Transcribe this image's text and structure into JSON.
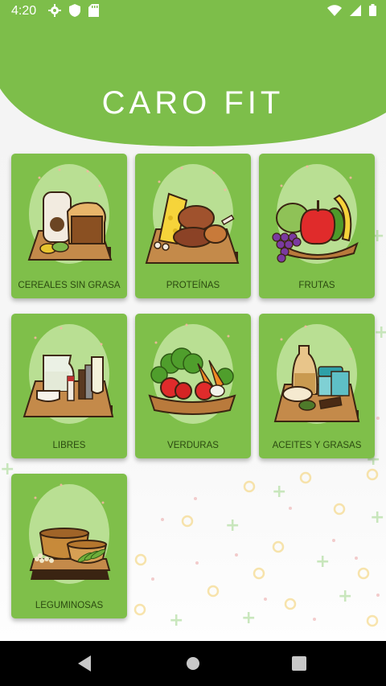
{
  "status_bar": {
    "time": "4:20",
    "left_icons": [
      "gear-icon",
      "shield-icon",
      "sd-card-icon"
    ],
    "right_icons": [
      "wifi-icon",
      "signal-icon",
      "battery-icon"
    ]
  },
  "header": {
    "title": "CARO FIT",
    "color": "#7dbe4a"
  },
  "categories": [
    {
      "label": "CEREALES SIN GRASA",
      "illustration": "bread-and-cereal-icon"
    },
    {
      "label": "PROTEÍNAS",
      "illustration": "meat-and-cheese-icon"
    },
    {
      "label": "FRUTAS",
      "illustration": "fruit-basket-icon"
    },
    {
      "label": "LIBRES",
      "illustration": "drinks-and-condiments-icon"
    },
    {
      "label": "VERDURAS",
      "illustration": "vegetable-basket-icon"
    },
    {
      "label": "ACEITES Y GRASAS",
      "illustration": "oils-and-fats-icon"
    },
    {
      "label": "LEGUMINOSAS",
      "illustration": "legumes-bowls-icon"
    }
  ],
  "nav_bar": {
    "buttons": [
      "back-icon",
      "home-icon",
      "recents-icon"
    ]
  },
  "colors": {
    "card": "#7fbf4a",
    "card_label": "#2b4a10",
    "nav_bar": "#000000"
  }
}
